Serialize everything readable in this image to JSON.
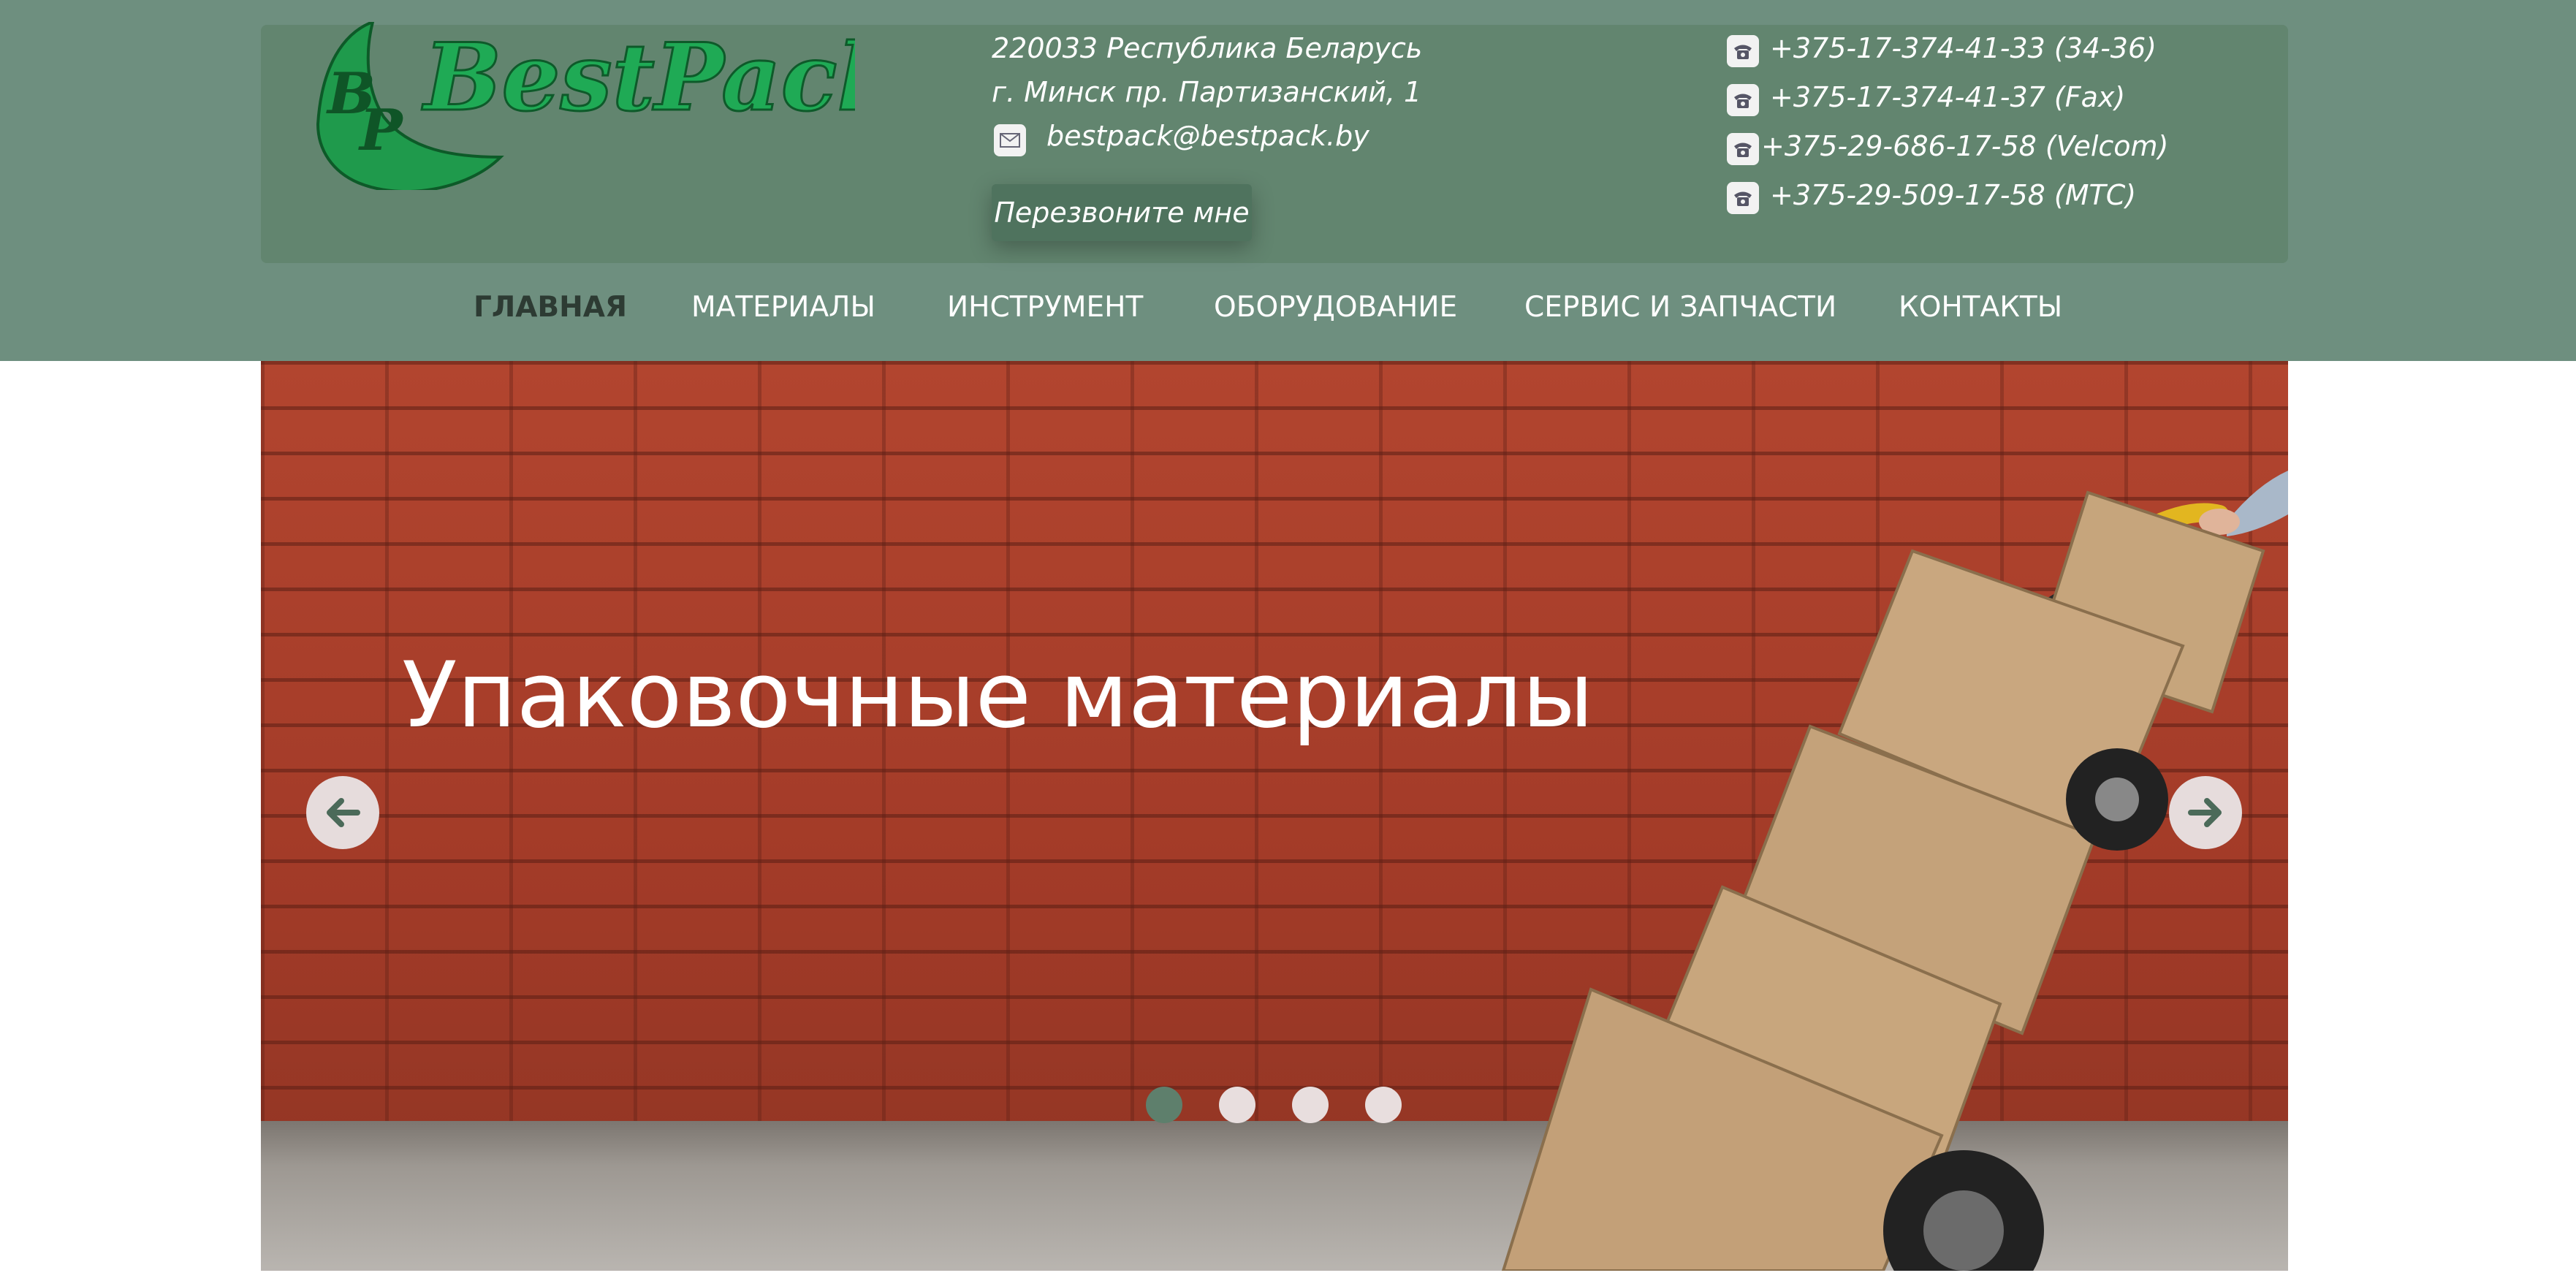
{
  "brand": {
    "logo_monogram_b": "B",
    "logo_monogram_p": "P",
    "logo_text": "BestPack"
  },
  "contact": {
    "address_line1": "220033 Республика Беларусь",
    "address_line2": "г. Минск пр. Партизанский, 1",
    "email": "bestpack@bestpack.by",
    "callback_label": "Перезвоните мне"
  },
  "phones": [
    {
      "text": "+375-17-374-41-33 (34-36)"
    },
    {
      "text": "+375-17-374-41-37 (Fax)"
    },
    {
      "text": "+375-29-686-17-58 (Velcom)"
    },
    {
      "text": "+375-29-509-17-58 (МТС)"
    }
  ],
  "nav": [
    {
      "label": "ГЛАВНАЯ",
      "active": true
    },
    {
      "label": "МАТЕРИАЛЫ"
    },
    {
      "label": "ИНСТРУМЕНТ"
    },
    {
      "label": "ОБОРУДОВАНИЕ"
    },
    {
      "label": "СЕРВИС И ЗАПЧАСТИ"
    },
    {
      "label": "КОНТАКТЫ"
    }
  ],
  "slider": {
    "title": "Упаковочные материалы",
    "prev_icon": "arrow-left-icon",
    "next_icon": "arrow-right-icon",
    "slides_count": 4,
    "active_index": 0
  },
  "icons": {
    "email": "envelope-icon",
    "phone": "telephone-icon"
  },
  "colors": {
    "header_band": "#6e8f7f",
    "header_box": "#62856f",
    "logo_green": "#1f9a4c",
    "nav_active": "#2d3b33",
    "accent_button": "#4f735e"
  }
}
